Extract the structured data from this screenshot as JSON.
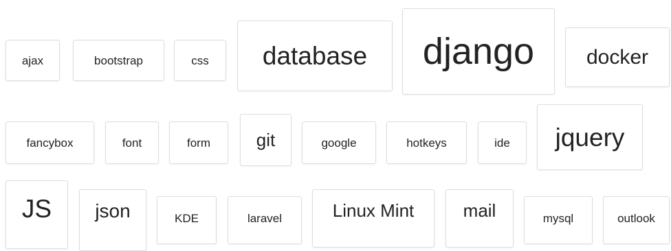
{
  "tags": [
    {
      "id": "ajax",
      "label": "ajax"
    },
    {
      "id": "bootstrap",
      "label": "bootstrap"
    },
    {
      "id": "css",
      "label": "css"
    },
    {
      "id": "database",
      "label": "database"
    },
    {
      "id": "django",
      "label": "django"
    },
    {
      "id": "docker",
      "label": "docker"
    },
    {
      "id": "fancybox",
      "label": "fancybox"
    },
    {
      "id": "font",
      "label": "font"
    },
    {
      "id": "form",
      "label": "form"
    },
    {
      "id": "git",
      "label": "git"
    },
    {
      "id": "google",
      "label": "google"
    },
    {
      "id": "hotkeys",
      "label": "hotkeys"
    },
    {
      "id": "ide",
      "label": "ide"
    },
    {
      "id": "jquery",
      "label": "jquery"
    },
    {
      "id": "js",
      "label": "JS"
    },
    {
      "id": "json",
      "label": "json"
    },
    {
      "id": "kde",
      "label": "KDE"
    },
    {
      "id": "laravel",
      "label": "laravel"
    },
    {
      "id": "linux-mint",
      "label": "Linux Mint"
    },
    {
      "id": "mail",
      "label": "mail"
    },
    {
      "id": "mysql",
      "label": "mysql"
    },
    {
      "id": "outlook",
      "label": "outlook"
    }
  ]
}
